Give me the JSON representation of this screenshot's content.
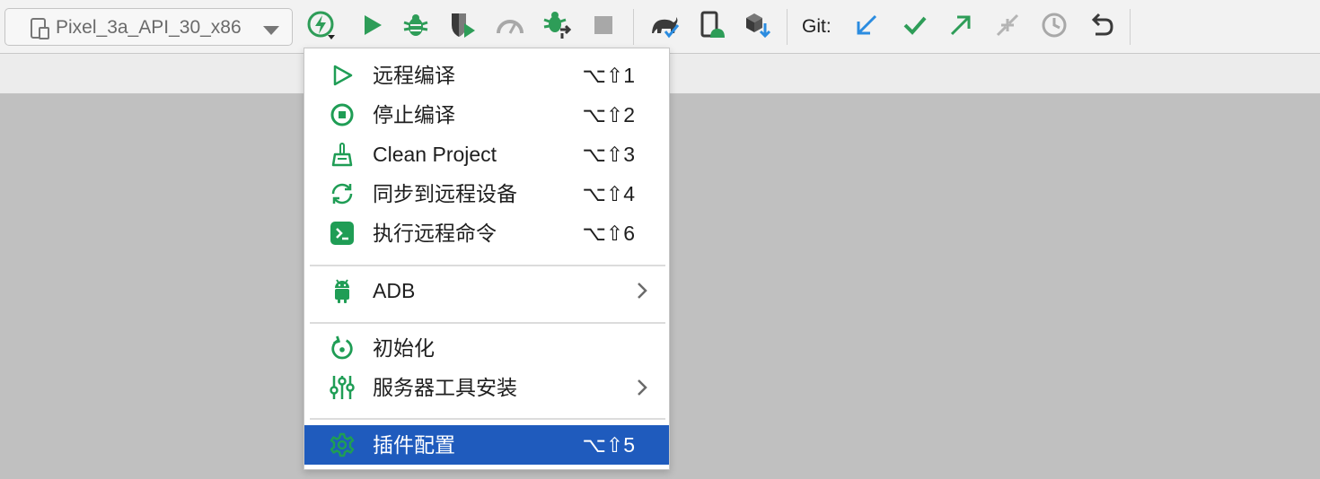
{
  "toolbar": {
    "device": {
      "name": "Pixel_3a_API_30_x86"
    },
    "git_label": "Git:",
    "buttons": [
      {
        "icon": "remote-build-icon",
        "color": "#2e9d58"
      },
      {
        "icon": "run-icon",
        "color": "#2e9d58"
      },
      {
        "icon": "debug-icon",
        "color": "#2e9d58"
      },
      {
        "icon": "run-with-coverage-icon",
        "color": "#2e9d58"
      },
      {
        "icon": "profile-icon",
        "color": "#a8a8a8"
      },
      {
        "icon": "attach-debugger-icon",
        "color": "#2e9d58"
      },
      {
        "icon": "stop-icon",
        "color": "#a8a8a8"
      },
      {
        "icon": "gradle-sync-icon",
        "color": "#3a3a3a"
      },
      {
        "icon": "device-manager-icon",
        "color": "#3a3a3a"
      },
      {
        "icon": "sdk-manager-icon",
        "color": "#3a3a3a"
      },
      {
        "icon": "git-update-icon",
        "color": "#2b8ce0"
      },
      {
        "icon": "git-commit-icon",
        "color": "#2e9d58"
      },
      {
        "icon": "git-push-icon",
        "color": "#2e9d58"
      },
      {
        "icon": "git-merge-icon",
        "color": "#b4b4b4"
      },
      {
        "icon": "git-history-icon",
        "color": "#a8a8a8"
      },
      {
        "icon": "git-rollback-icon",
        "color": "#3a3a3a"
      }
    ]
  },
  "menu": {
    "items": [
      {
        "label": "远程编译",
        "shortcut": "⌥⇧1",
        "icon": "play-outline-icon"
      },
      {
        "label": "停止编译",
        "shortcut": "⌥⇧2",
        "icon": "stop-circle-icon"
      },
      {
        "label": "Clean Project",
        "shortcut": "⌥⇧3",
        "icon": "broom-icon"
      },
      {
        "label": "同步到远程设备",
        "shortcut": "⌥⇧4",
        "icon": "sync-icon"
      },
      {
        "label": "执行远程命令",
        "shortcut": "⌥⇧6",
        "icon": "terminal-icon"
      },
      {
        "label": "ADB",
        "icon": "android-icon",
        "submenu": true
      },
      {
        "label": "初始化",
        "icon": "refresh-icon"
      },
      {
        "label": "服务器工具安装",
        "icon": "sliders-icon",
        "submenu": true
      },
      {
        "label": "插件配置",
        "shortcut": "⌥⇧5",
        "icon": "gear-icon",
        "selected": true
      }
    ],
    "accent_color": "#1f5bbd",
    "icon_color": "#1f9d55"
  }
}
